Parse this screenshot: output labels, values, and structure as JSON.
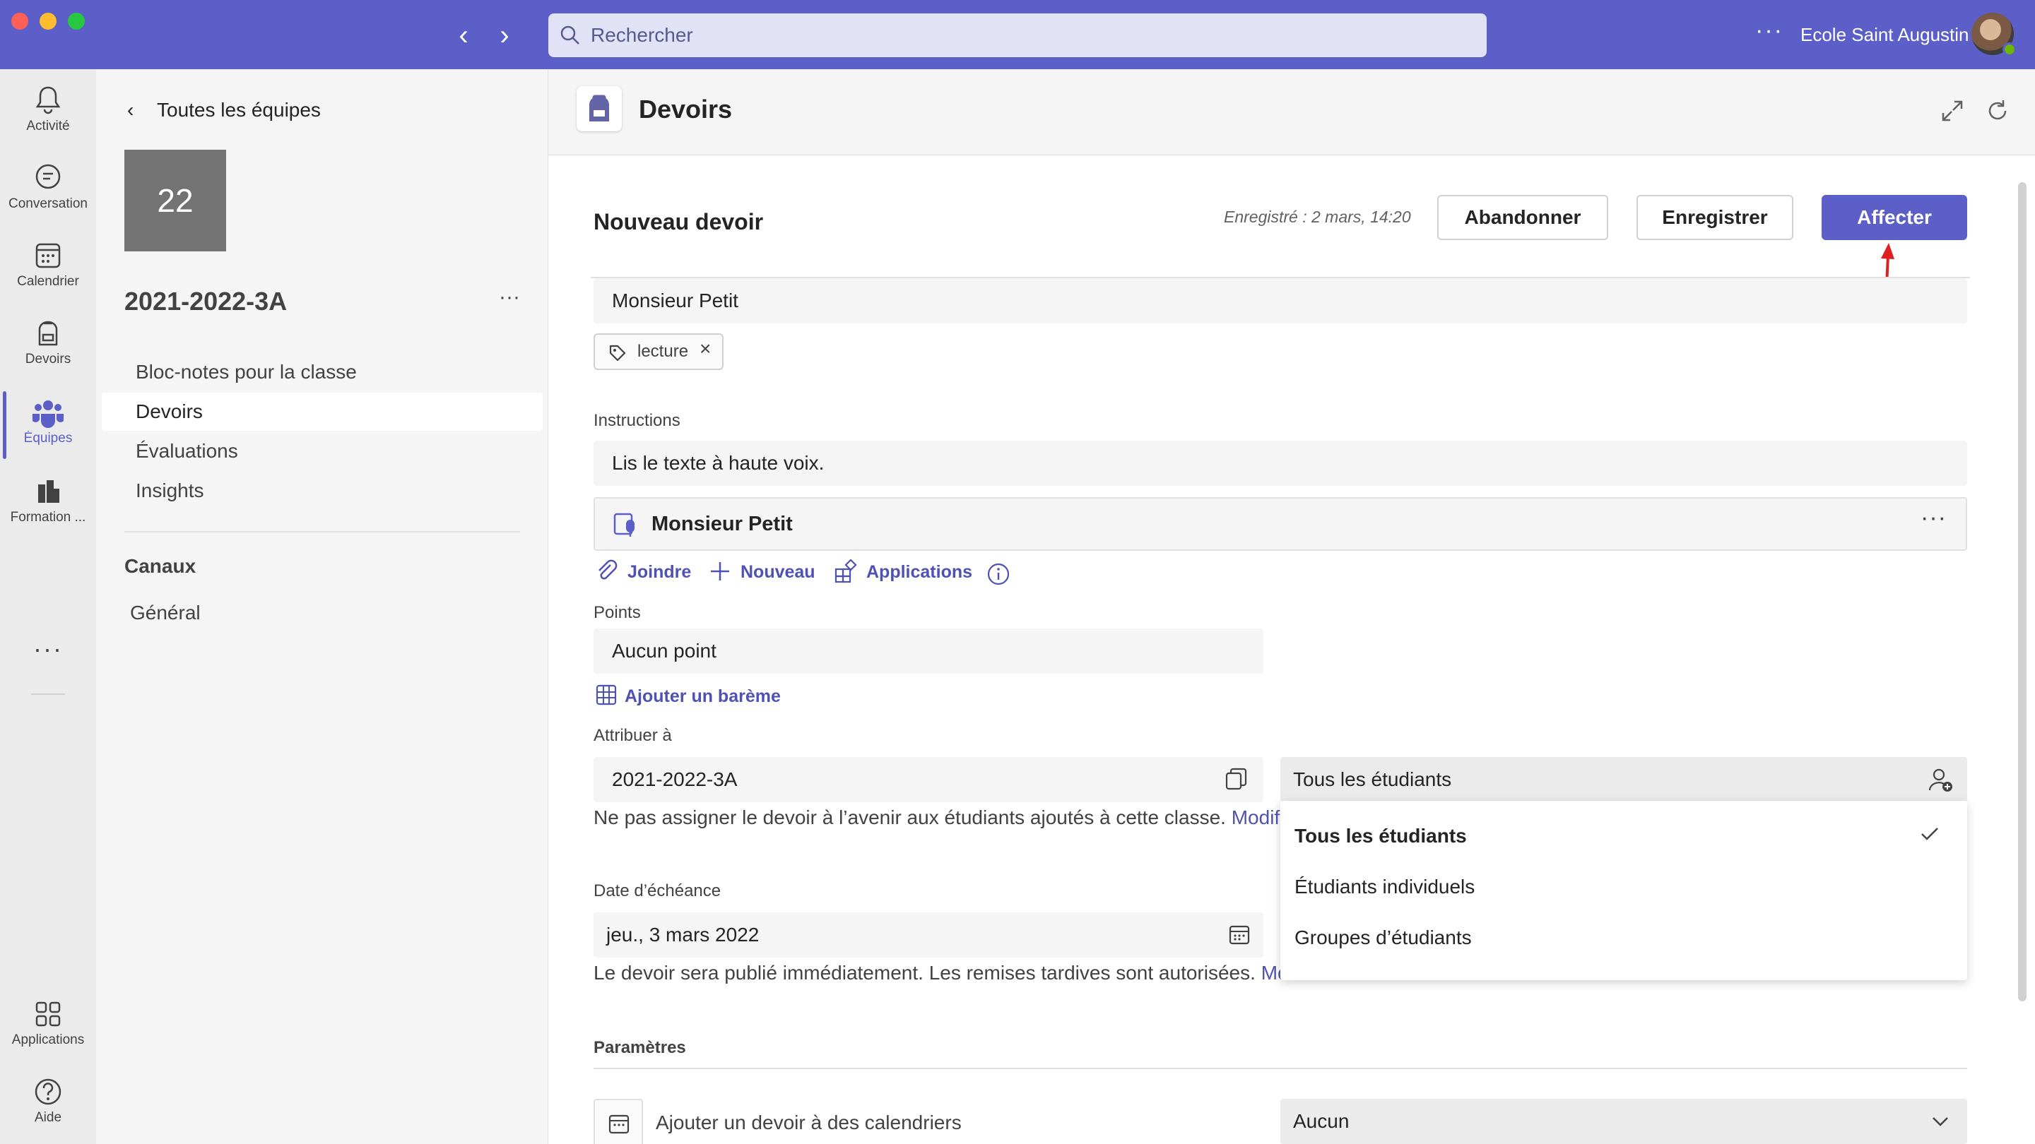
{
  "titlebar": {
    "search_placeholder": "Rechercher",
    "more": "···",
    "org_name": "Ecole Saint Augustin"
  },
  "rail": {
    "items": [
      {
        "label": "Activité",
        "icon": "bell-icon"
      },
      {
        "label": "Conversation",
        "icon": "chat-icon"
      },
      {
        "label": "Calendrier",
        "icon": "calendar-icon"
      },
      {
        "label": "Devoirs",
        "icon": "backpack-icon"
      },
      {
        "label": "Équipes",
        "icon": "teams-icon",
        "active": true
      },
      {
        "label": "Formation ...",
        "icon": "books-icon"
      },
      {
        "label": "Applications",
        "icon": "apps-icon"
      },
      {
        "label": "Aide",
        "icon": "help-icon"
      }
    ],
    "more": "···"
  },
  "team_panel": {
    "back_label": "Toutes les équipes",
    "tile_text": "22",
    "team_name": "2021-2022-3A",
    "more": "···",
    "links": [
      "Bloc-notes pour la classe",
      "Devoirs",
      "Évaluations",
      "Insights"
    ],
    "selected_link": "Devoirs",
    "section_title": "Canaux",
    "channels": [
      "Général"
    ]
  },
  "main": {
    "app_title": "Devoirs",
    "header": {
      "title": "Nouveau devoir",
      "saved_status": "Enregistré : 2 mars, 14:20",
      "buttons": {
        "abandon": "Abandonner",
        "save": "Enregistrer",
        "assign": "Affecter"
      }
    },
    "title_field": "Monsieur Petit",
    "tag": "lecture",
    "instructions_label": "Instructions",
    "instructions_value": "Lis le texte à haute voix.",
    "resource": {
      "name": "Monsieur Petit",
      "more": "···"
    },
    "actions": {
      "attach": "Joindre",
      "new": "Nouveau",
      "apps": "Applications"
    },
    "points_label": "Points",
    "points_value": "Aucun point",
    "rubric_link": "Ajouter un barème",
    "assign_label": "Attribuer à",
    "assign_class": "2021-2022-3A",
    "assign_students": "Tous les étudiants",
    "assign_help": "Ne pas assigner le devoir à l’avenir aux étudiants ajoutés à cette classe.",
    "assign_help_link": "Modifier",
    "due_label": "Date d’échéance",
    "due_value": "jeu., 3 mars 2022",
    "due_help": "Le devoir sera publié immédiatement. Les remises tardives sont autorisées.",
    "due_help_link": "Modifier",
    "settings_label": "Paramètres",
    "calendar_label": "Ajouter un devoir à des calendriers",
    "calendar_value": "Aucun",
    "dropdown_options": [
      "Tous les étudiants",
      "Étudiants individuels",
      "Groupes d’étudiants"
    ],
    "dropdown_selected": "Tous les étudiants"
  },
  "colors": {
    "brand": "#5b5fc7",
    "link": "#4f52b2",
    "annotation": "#e02020"
  }
}
